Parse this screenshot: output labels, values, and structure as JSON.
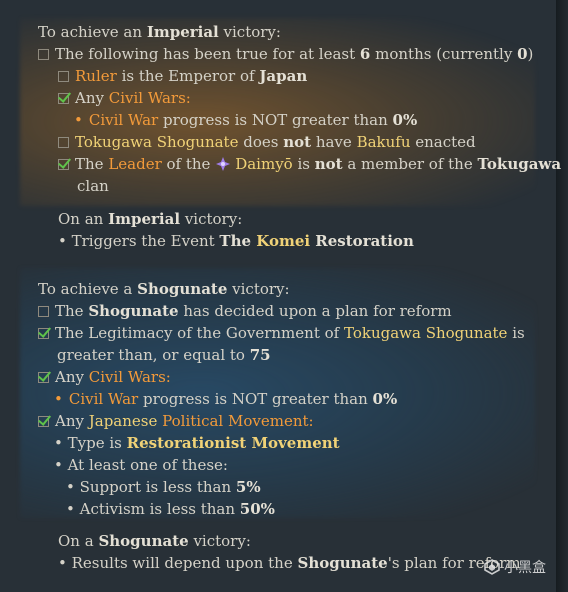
{
  "imperial": {
    "heading": {
      "pre": "To achieve an ",
      "key": "Imperial",
      "post": " victory:"
    },
    "cond_time": {
      "pre": "The following has been true for at least ",
      "n": "6",
      "mid": " months (currently ",
      "cur": "0",
      "post": ")"
    },
    "cond_ruler": {
      "a": "Ruler",
      "b": " is the Emperor of ",
      "c": "Japan"
    },
    "cond_civilwars": {
      "a": "Any ",
      "b": "Civil Wars",
      "c": ":"
    },
    "cond_civilwar_progress": {
      "a": "Civil War",
      "b": " progress is NOT greater than ",
      "c": "0%"
    },
    "cond_bakufu": {
      "a": "Tokugawa Shogunate",
      "b": " does ",
      "c": "not",
      "d": " have ",
      "e": "Bakufu",
      "f": " enacted"
    },
    "cond_leader": {
      "a": "The ",
      "b": "Leader",
      "c": " of the ",
      "d": "Daimyō",
      "e": " is ",
      "f": "not",
      "g": " a member of the ",
      "h": "Tokugawa",
      "i": "clan"
    },
    "outcome_heading": {
      "a": "On an ",
      "b": "Imperial",
      "c": " victory:"
    },
    "outcome": {
      "a": "• Triggers the Event ",
      "b": "The ",
      "c": "Komei",
      "d": " Restoration"
    }
  },
  "shogunate": {
    "heading": {
      "pre": "To achieve a ",
      "key": "Shogunate",
      "post": " victory:"
    },
    "cond_plan": {
      "a": "The ",
      "b": "Shogunate",
      "c": " has decided upon a plan for reform"
    },
    "cond_legit": {
      "a": "The Legitimacy of the Government of ",
      "b": "Tokugawa Shogunate",
      "c": " is",
      "d": "greater than, or equal to ",
      "e": "75"
    },
    "cond_civilwars": {
      "a": "Any ",
      "b": "Civil Wars",
      "c": ":"
    },
    "cond_civilwar_progress": {
      "a": "Civil War",
      "b": " progress is NOT greater than ",
      "c": "0%"
    },
    "cond_movement": {
      "a": "Any ",
      "b": "Japanese",
      "c": " ",
      "d": "Political Movement",
      "e": ":"
    },
    "cond_type": {
      "a": "• Type is ",
      "b": "Restorationist Movement"
    },
    "cond_atleast": {
      "a": "• At least one of these:"
    },
    "cond_support": {
      "a": "• Support is less than ",
      "b": "5%"
    },
    "cond_activism": {
      "a": "• Activism is less than ",
      "b": "50%"
    },
    "outcome_heading": {
      "a": "On a ",
      "b": "Shogunate",
      "c": " victory:"
    },
    "outcome": {
      "a": "• Results will depend upon the ",
      "b": "Shogunate",
      "c": "'s plan for reform"
    }
  },
  "watermark": {
    "text": "小黑盒"
  },
  "colors": {
    "yellow": "#f0d277",
    "orange": "#f29a3a",
    "check": "#5fc24a",
    "imperial_glow": "#aa6e28",
    "shogunate_glow": "#285a82"
  }
}
